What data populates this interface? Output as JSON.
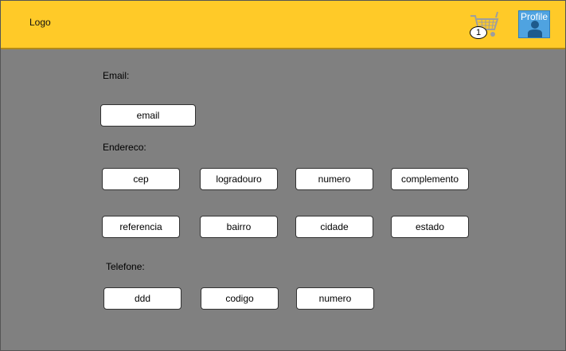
{
  "header": {
    "logo_text": "Logo",
    "cart_count": "1",
    "profile_label": "Profile"
  },
  "form": {
    "email_label": "Email:",
    "email_field": "email",
    "address_label": "Endereco:",
    "address_fields": {
      "cep": "cep",
      "logradouro": "logradouro",
      "numero": "numero",
      "complemento": "complemento",
      "referencia": "referencia",
      "bairro": "bairro",
      "cidade": "cidade",
      "estado": "estado"
    },
    "phone_label": "Telefone:",
    "phone_fields": {
      "ddd": "ddd",
      "codigo": "codigo",
      "numero": "numero"
    }
  },
  "colors": {
    "header_bg": "#FFCA28",
    "page_bg": "#808080",
    "profile_bg": "#4FA3E0"
  }
}
